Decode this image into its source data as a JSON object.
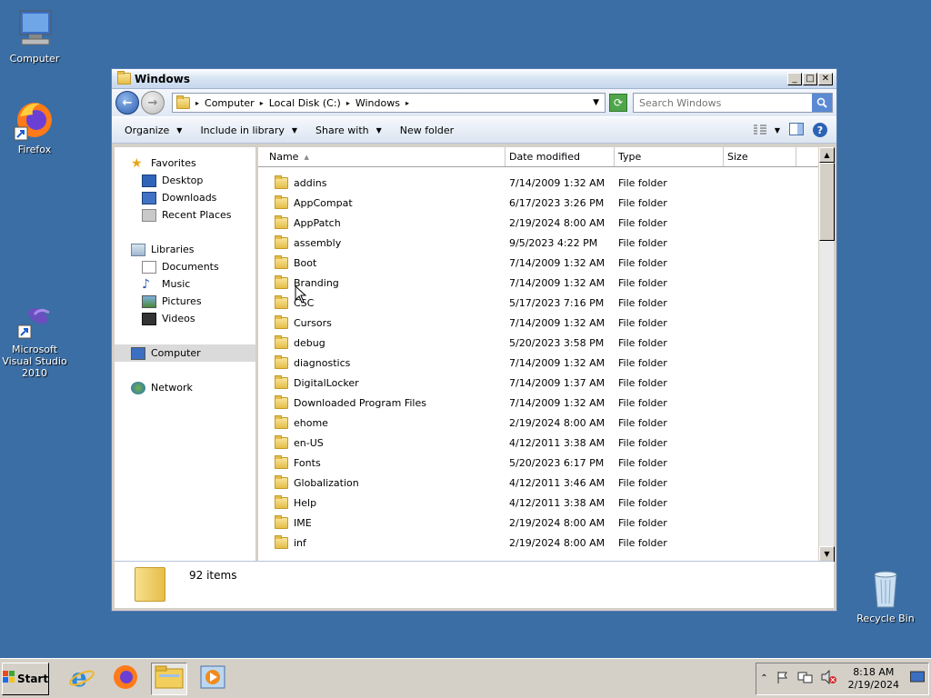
{
  "desktop": {
    "icons": [
      {
        "label": "Computer"
      },
      {
        "label": "Firefox"
      },
      {
        "label": "Microsoft Visual Studio 2010"
      },
      {
        "label": "Recycle Bin"
      }
    ]
  },
  "window": {
    "title": "Windows",
    "controls": {
      "minimize": "_",
      "maximize": "□",
      "close": "✕"
    },
    "address": {
      "crumbs": [
        "Computer",
        "Local Disk (C:)",
        "Windows"
      ],
      "search_placeholder": "Search Windows"
    },
    "toolbar": {
      "organize": "Organize",
      "include_in_library": "Include in library",
      "share_with": "Share with",
      "new_folder": "New folder"
    },
    "nav": {
      "favorites": "Favorites",
      "desktop": "Desktop",
      "downloads": "Downloads",
      "recent_places": "Recent Places",
      "libraries": "Libraries",
      "documents": "Documents",
      "music": "Music",
      "pictures": "Pictures",
      "videos": "Videos",
      "computer": "Computer",
      "network": "Network"
    },
    "columns": {
      "name": "Name",
      "date": "Date modified",
      "type": "Type",
      "size": "Size"
    },
    "files": [
      {
        "name": "addins",
        "date": "7/14/2009 1:32 AM",
        "type": "File folder"
      },
      {
        "name": "AppCompat",
        "date": "6/17/2023 3:26 PM",
        "type": "File folder"
      },
      {
        "name": "AppPatch",
        "date": "2/19/2024 8:00 AM",
        "type": "File folder"
      },
      {
        "name": "assembly",
        "date": "9/5/2023 4:22 PM",
        "type": "File folder"
      },
      {
        "name": "Boot",
        "date": "7/14/2009 1:32 AM",
        "type": "File folder"
      },
      {
        "name": "Branding",
        "date": "7/14/2009 1:32 AM",
        "type": "File folder"
      },
      {
        "name": "CSC",
        "date": "5/17/2023 7:16 PM",
        "type": "File folder"
      },
      {
        "name": "Cursors",
        "date": "7/14/2009 1:32 AM",
        "type": "File folder"
      },
      {
        "name": "debug",
        "date": "5/20/2023 3:58 PM",
        "type": "File folder"
      },
      {
        "name": "diagnostics",
        "date": "7/14/2009 1:32 AM",
        "type": "File folder"
      },
      {
        "name": "DigitalLocker",
        "date": "7/14/2009 1:37 AM",
        "type": "File folder"
      },
      {
        "name": "Downloaded Program Files",
        "date": "7/14/2009 1:32 AM",
        "type": "File folder"
      },
      {
        "name": "ehome",
        "date": "2/19/2024 8:00 AM",
        "type": "File folder"
      },
      {
        "name": "en-US",
        "date": "4/12/2011 3:38 AM",
        "type": "File folder"
      },
      {
        "name": "Fonts",
        "date": "5/20/2023 6:17 PM",
        "type": "File folder"
      },
      {
        "name": "Globalization",
        "date": "4/12/2011 3:46 AM",
        "type": "File folder"
      },
      {
        "name": "Help",
        "date": "4/12/2011 3:38 AM",
        "type": "File folder"
      },
      {
        "name": "IME",
        "date": "2/19/2024 8:00 AM",
        "type": "File folder"
      },
      {
        "name": "inf",
        "date": "2/19/2024 8:00 AM",
        "type": "File folder"
      }
    ],
    "details": {
      "item_count": "92 items"
    }
  },
  "taskbar": {
    "start_label": "Start",
    "clock_time": "8:18 AM",
    "clock_date": "2/19/2024"
  }
}
